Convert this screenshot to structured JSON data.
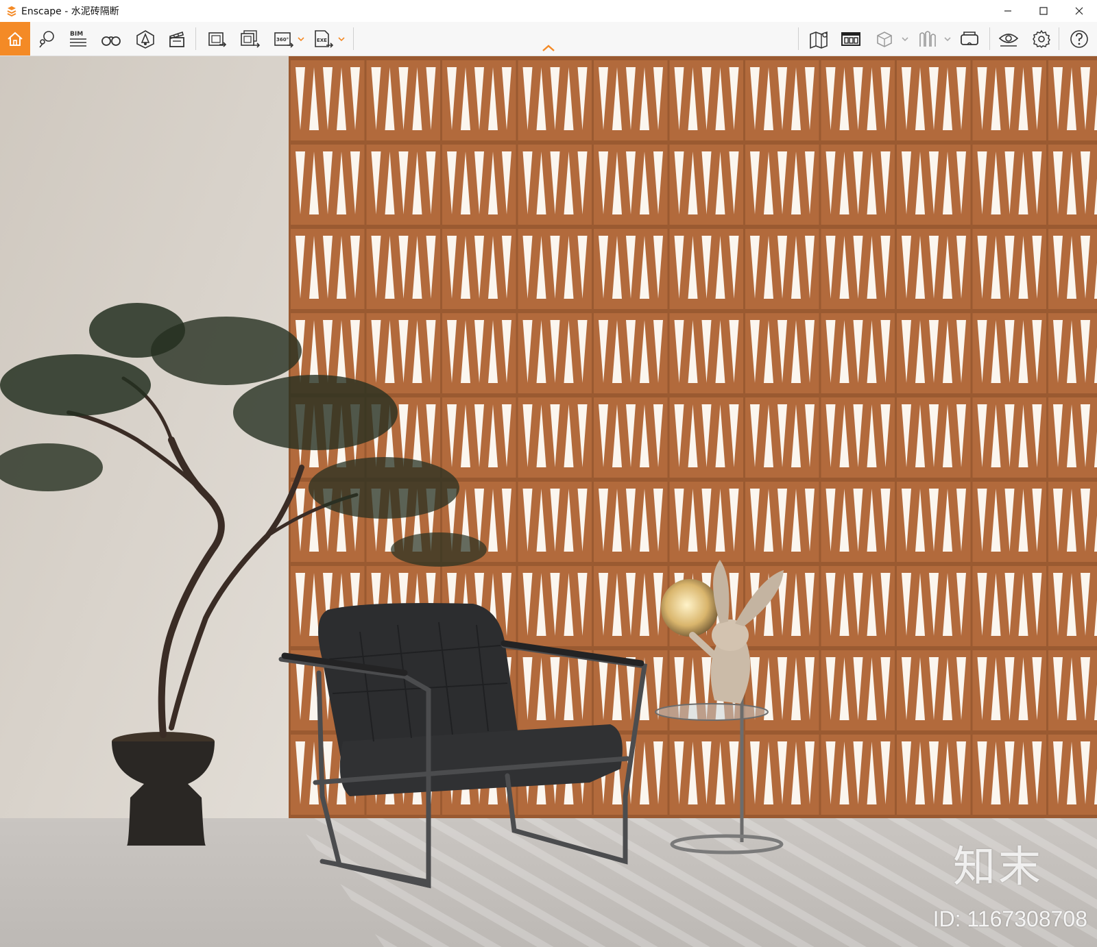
{
  "window": {
    "title": "Enscape - 水泥砖隔断",
    "controls": [
      "minimize",
      "maximize",
      "close"
    ]
  },
  "toolbar": {
    "left_tools": [
      {
        "name": "home-icon",
        "active": true
      },
      {
        "name": "sun-study-icon"
      },
      {
        "name": "bim-icon",
        "label": "BIM"
      },
      {
        "name": "binoculars-icon"
      },
      {
        "name": "asset-library-icon"
      },
      {
        "name": "video-editor-icon"
      },
      {
        "name": "screenshot-icon"
      },
      {
        "name": "batch-render-icon"
      },
      {
        "name": "panorama-icon",
        "label": "360°"
      },
      {
        "name": "export-exe-icon",
        "label": "EXE"
      }
    ],
    "right_tools": [
      {
        "name": "map-icon"
      },
      {
        "name": "view-management-icon"
      },
      {
        "name": "safe-frame-icon"
      },
      {
        "name": "collaboration-icon"
      },
      {
        "name": "vr-headset-icon"
      },
      {
        "name": "visual-settings-icon"
      },
      {
        "name": "settings-gear-icon"
      },
      {
        "name": "help-icon"
      }
    ],
    "accent_color": "#f48a26"
  },
  "viewport": {
    "watermark_brand": "知末",
    "watermark_id": "ID: 1167308708",
    "wall_color": "#b56d3e",
    "left_wall_color": "#d8d2ca"
  }
}
